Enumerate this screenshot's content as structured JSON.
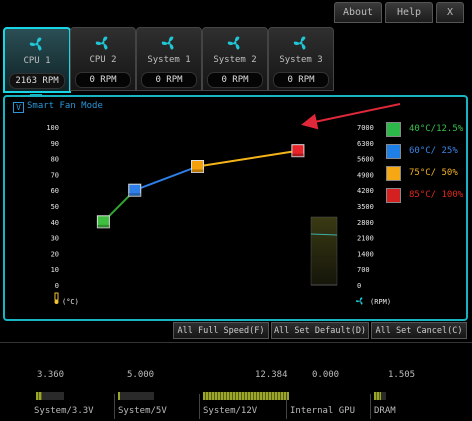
{
  "top_buttons": {
    "about": "About",
    "help": "Help",
    "close": "X"
  },
  "tabs": [
    {
      "label": "CPU 1",
      "rpm": "2163 RPM",
      "active": true
    },
    {
      "label": "CPU 2",
      "rpm": "0 RPM",
      "active": false
    },
    {
      "label": "System 1",
      "rpm": "0 RPM",
      "active": false
    },
    {
      "label": "System 2",
      "rpm": "0 RPM",
      "active": false
    },
    {
      "label": "System 3",
      "rpm": "0 RPM",
      "active": false
    }
  ],
  "smart_fan": {
    "checkbox": "V",
    "label": "Smart Fan Mode",
    "checked": true
  },
  "chart_data": {
    "type": "line",
    "y_left_ticks": [
      "100",
      "90",
      "80",
      "70",
      "60",
      "50",
      "40",
      "30",
      "20",
      "10",
      "0"
    ],
    "y_right_ticks": [
      "7000",
      "6300",
      "5600",
      "4900",
      "4200",
      "3500",
      "2800",
      "2100",
      "1400",
      "700",
      "0"
    ],
    "ylim_left": [
      0,
      100
    ],
    "ylim_right": [
      0,
      7000
    ],
    "x_unit": "(°C)",
    "right_unit": "(RPM)",
    "points": [
      {
        "temp": 12.5,
        "duty": 40,
        "color": "#3fbf3f"
      },
      {
        "temp": 25,
        "duty": 60,
        "color": "#2f7fe8"
      },
      {
        "temp": 50,
        "duty": 75,
        "color": "#f5a10a"
      },
      {
        "temp": 90,
        "duty": 85,
        "color": "#e8232a"
      }
    ],
    "current_rpm": 2163
  },
  "legend": [
    {
      "text": "40°C/12.5%",
      "color": "#2db84a",
      "text_color": "#36c24a"
    },
    {
      "text": "60°C/  25%",
      "color": "#1e7fe6",
      "text_color": "#3a86e8"
    },
    {
      "text": "75°C/  50%",
      "color": "#f5a814",
      "text_color": "#f0b020"
    },
    {
      "text": "85°C/ 100%",
      "color": "#d42020",
      "text_color": "#e0281c"
    }
  ],
  "bottom_buttons": [
    "All Full Speed(F)",
    "All Set Default(D)",
    "All Set Cancel(C)"
  ],
  "voltages": [
    {
      "value": "3.360",
      "label": "System/3.3V",
      "fill": 0.2
    },
    {
      "value": "5.000",
      "label": "System/5V",
      "fill": 0.05
    },
    {
      "value": "12.384",
      "label": "System/12V",
      "fill": 1.0
    },
    {
      "value": "0.000",
      "label": "Internal GPU",
      "fill": 0
    },
    {
      "value": "1.505",
      "label": "DRAM",
      "fill": 0.6
    }
  ],
  "colors": {
    "accent": "#17b5c4",
    "arrow": "#e0283a"
  }
}
